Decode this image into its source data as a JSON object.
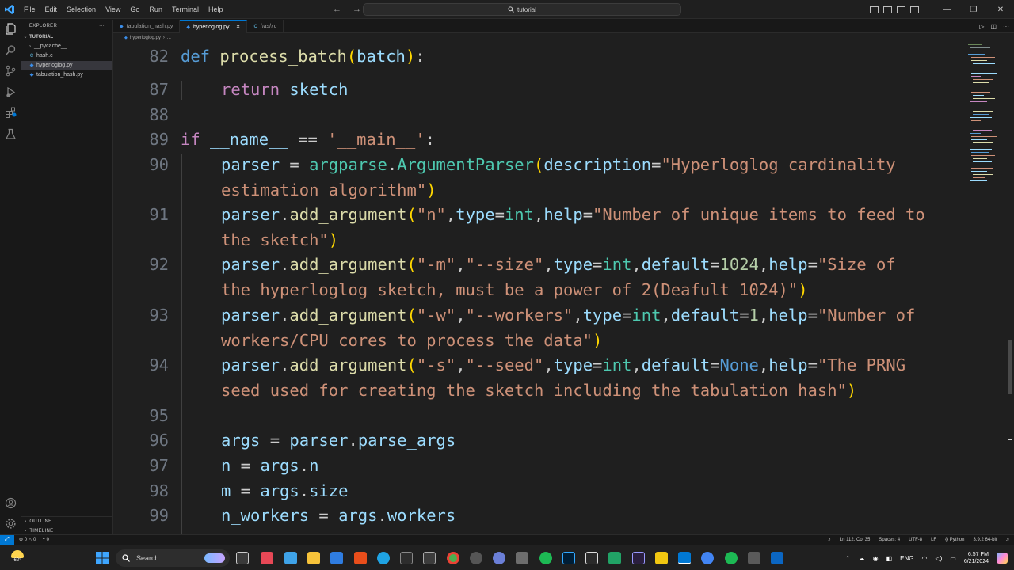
{
  "titlebar": {
    "menu": [
      "File",
      "Edit",
      "Selection",
      "View",
      "Go",
      "Run",
      "Terminal",
      "Help"
    ],
    "search_text": "tutorial"
  },
  "sidebar": {
    "header": "EXPLORER",
    "folder": "TUTORIAL",
    "items": [
      {
        "label": "__pycache__",
        "kind": "folder"
      },
      {
        "label": "hash.c",
        "kind": "c"
      },
      {
        "label": "hyperloglog.py",
        "kind": "py"
      },
      {
        "label": "tabulation_hash.py",
        "kind": "py"
      }
    ],
    "outline": "OUTLINE",
    "timeline": "TIMELINE"
  },
  "tabs": [
    {
      "label": "tabulation_hash.py",
      "active": false
    },
    {
      "label": "hyperloglog.py",
      "active": true
    },
    {
      "label": "hash.c",
      "active": false
    }
  ],
  "breadcrumb": {
    "file": "hyperloglog.py",
    "rest": "..."
  },
  "code_lines": [
    {
      "num": "82",
      "line": "def process_batch(batch):"
    },
    {
      "num": "87",
      "line": "return sketch"
    },
    {
      "num": "88",
      "line": ""
    },
    {
      "num": "89",
      "line": "if __name__ == '__main__':"
    },
    {
      "num": "90",
      "line": "parser = argparse.ArgumentParser(description=\"Hyperloglog cardinality",
      "cont": "estimation algorithm\")"
    },
    {
      "num": "91",
      "line": "parser.add_argument(\"n\",type=int,help=\"Number of unique items to feed to",
      "cont": "the sketch\")"
    },
    {
      "num": "92",
      "line": "parser.add_argument(\"-m\",\"--size\",type=int,default=1024,help=\"Size of",
      "cont": "the hyperloglog sketch, must be a power of 2(Deafult 1024)\")"
    },
    {
      "num": "93",
      "line": "parser.add_argument(\"-w\",\"--workers\",type=int,default=1,help=\"Number of",
      "cont": "workers/CPU cores to process the data\")"
    },
    {
      "num": "94",
      "line": "parser.add_argument(\"-s\",\"--seed\",type=int,default=None,help=\"The PRNG",
      "cont": "seed used for creating the sketch including the tabulation hash\")"
    },
    {
      "num": "95",
      "line": ""
    },
    {
      "num": "96",
      "line": "args = parser.parse_args"
    },
    {
      "num": "97",
      "line": "n = args.n"
    },
    {
      "num": "98",
      "line": "m = args.size"
    },
    {
      "num": "99",
      "line": "n_workers = args.workers"
    }
  ],
  "statusbar": {
    "errors": "0",
    "warnings": "0",
    "ports": "0",
    "position": "Ln 112, Col 35",
    "spaces": "Spaces: 4",
    "encoding": "UTF-8",
    "eol": "LF",
    "language": "Python",
    "interpreter": "3.9.2 64-bit"
  },
  "taskbar": {
    "weather": "62°",
    "search_placeholder": "Search",
    "lang": "ENG",
    "time": "6:57 PM",
    "date": "6/21/2024"
  },
  "colors": {
    "accent": "#0078d4",
    "keyword": "#569cd6",
    "string": "#ce9178",
    "number": "#b5cea8",
    "function": "#dcdcaa",
    "class": "#4ec9b0",
    "variable": "#9cdcfe"
  }
}
